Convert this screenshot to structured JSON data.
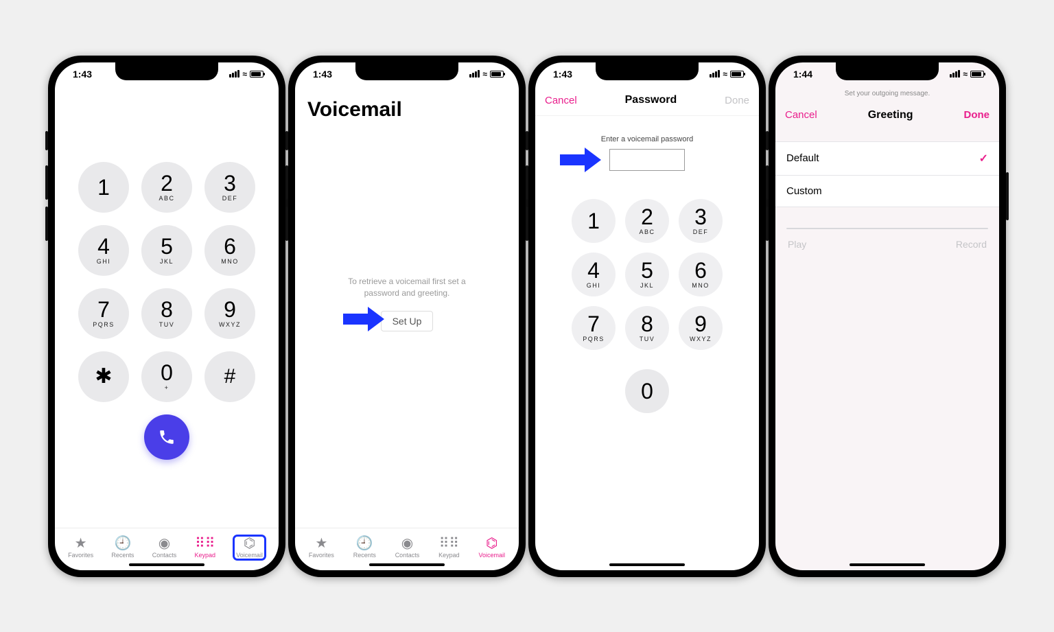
{
  "status": {
    "time1": "1:43",
    "time2": "1:43",
    "time3": "1:43",
    "time4": "1:44"
  },
  "keypad": {
    "keys": [
      {
        "d": "1",
        "l": ""
      },
      {
        "d": "2",
        "l": "ABC"
      },
      {
        "d": "3",
        "l": "DEF"
      },
      {
        "d": "4",
        "l": "GHI"
      },
      {
        "d": "5",
        "l": "JKL"
      },
      {
        "d": "6",
        "l": "MNO"
      },
      {
        "d": "7",
        "l": "PQRS"
      },
      {
        "d": "8",
        "l": "TUV"
      },
      {
        "d": "9",
        "l": "WXYZ"
      },
      {
        "d": "✱",
        "l": "",
        "sym": true
      },
      {
        "d": "0",
        "l": "+"
      },
      {
        "d": "#",
        "l": "",
        "sym": true
      }
    ]
  },
  "tabs": {
    "favorites": "Favorites",
    "recents": "Recents",
    "contacts": "Contacts",
    "keypad": "Keypad",
    "voicemail": "Voicemail"
  },
  "voicemail": {
    "title": "Voicemail",
    "msg": "To retrieve a voicemail first set a password and greeting.",
    "setup": "Set Up"
  },
  "password": {
    "cancel": "Cancel",
    "title": "Password",
    "done": "Done",
    "prompt": "Enter a voicemail password",
    "keys": [
      {
        "d": "1",
        "l": ""
      },
      {
        "d": "2",
        "l": "ABC"
      },
      {
        "d": "3",
        "l": "DEF"
      },
      {
        "d": "4",
        "l": "GHI"
      },
      {
        "d": "5",
        "l": "JKL"
      },
      {
        "d": "6",
        "l": "MNO"
      },
      {
        "d": "7",
        "l": "PQRS"
      },
      {
        "d": "8",
        "l": "TUV"
      },
      {
        "d": "9",
        "l": "WXYZ"
      }
    ],
    "zero": {
      "d": "0",
      "l": ""
    }
  },
  "greeting": {
    "prompt": "Set your outgoing message.",
    "cancel": "Cancel",
    "title": "Greeting",
    "done": "Done",
    "default": "Default",
    "custom": "Custom",
    "play": "Play",
    "record": "Record"
  }
}
